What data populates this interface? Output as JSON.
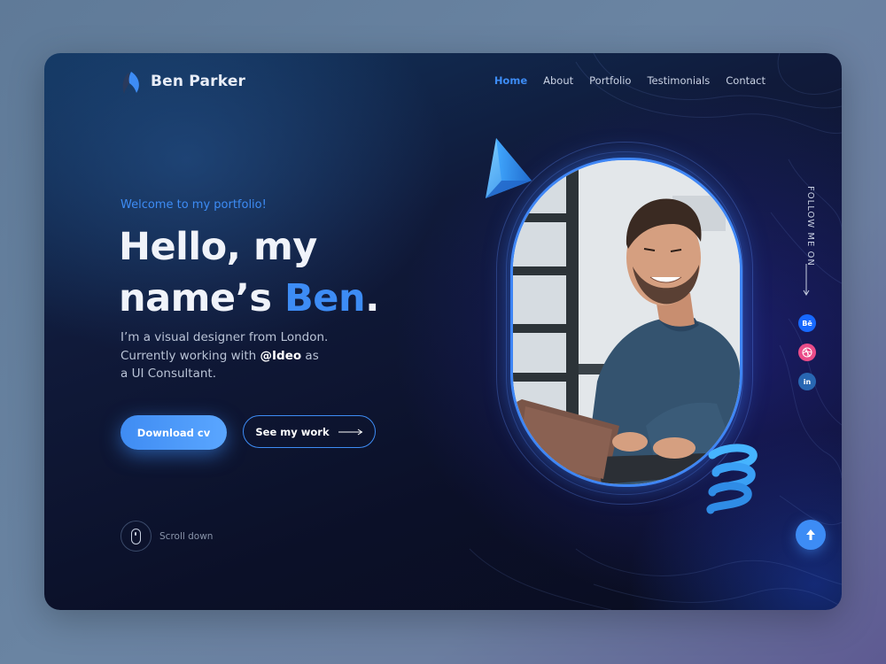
{
  "brand": {
    "name": "Ben Parker"
  },
  "nav": {
    "items": [
      "Home",
      "About",
      "Portfolio",
      "Testimonials",
      "Contact"
    ],
    "active": "Home"
  },
  "hero": {
    "welcome": "Welcome to my portfolio!",
    "title_line1": "Hello, my",
    "title_line2_prefix": "name’s ",
    "title_name": "Ben",
    "title_period": ".",
    "bio_line1": "I’m a visual designer from London.",
    "bio_line2_prefix": "Currently working with ",
    "bio_company": "@Ideo",
    "bio_line2_suffix": " as",
    "bio_line3": "a UI Consultant.",
    "primary_button": "Download cv",
    "secondary_button": "See my work",
    "scroll_hint": "Scroll down"
  },
  "social": {
    "follow_label": "FOLLOW ME ON",
    "behance_label": "Bē",
    "linkedin_label": "in"
  },
  "colors": {
    "accent": "#3d8cf5",
    "behance": "#1769ff",
    "dribbble": "#ea4c89",
    "linkedin": "#2867b2"
  },
  "icons": [
    "logo-icon",
    "mouse-icon",
    "arrow-right-icon",
    "behance-icon",
    "dribbble-icon",
    "linkedin-icon",
    "arrow-up-icon",
    "arrow-down-icon"
  ]
}
